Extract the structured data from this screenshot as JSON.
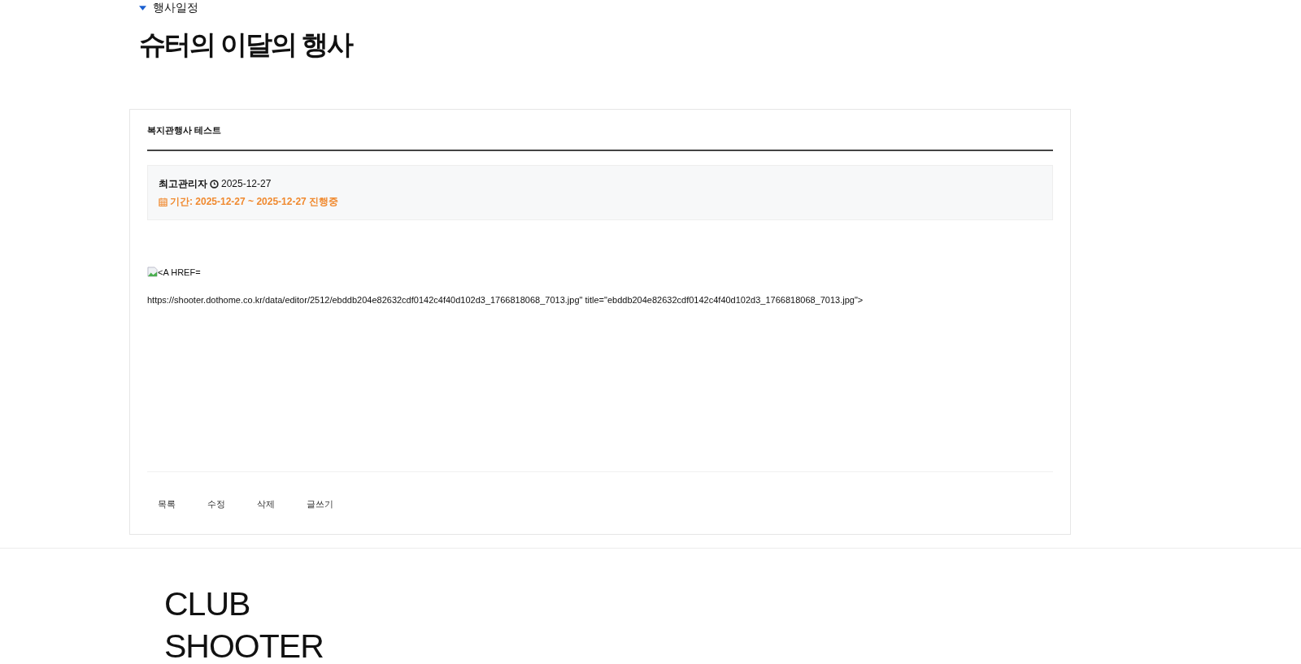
{
  "breadcrumb": "행사일정",
  "page_title": "슈터의 이달의 행사",
  "post": {
    "title": "복지관행사 테스트",
    "author": "최고관리자",
    "date": "2025-12-27",
    "period": "기간: 2025-12-27 ~ 2025-12-27 진행중",
    "body_lines": [
      "<A HREF=",
      "https://shooter.dothome.co.kr/data/editor/2512/ebddb204e82632cdf0142c4f40d102d3_1766818068_7013.jpg\" title=\"ebddb204e82632cdf0142c4f40d102d3_1766818068_7013.jpg\">"
    ],
    "actions": [
      "목록",
      "수정",
      "삭제",
      "글쓰기"
    ]
  },
  "footer": {
    "logo_lines": [
      "CLUB",
      "SHOOTER"
    ]
  }
}
